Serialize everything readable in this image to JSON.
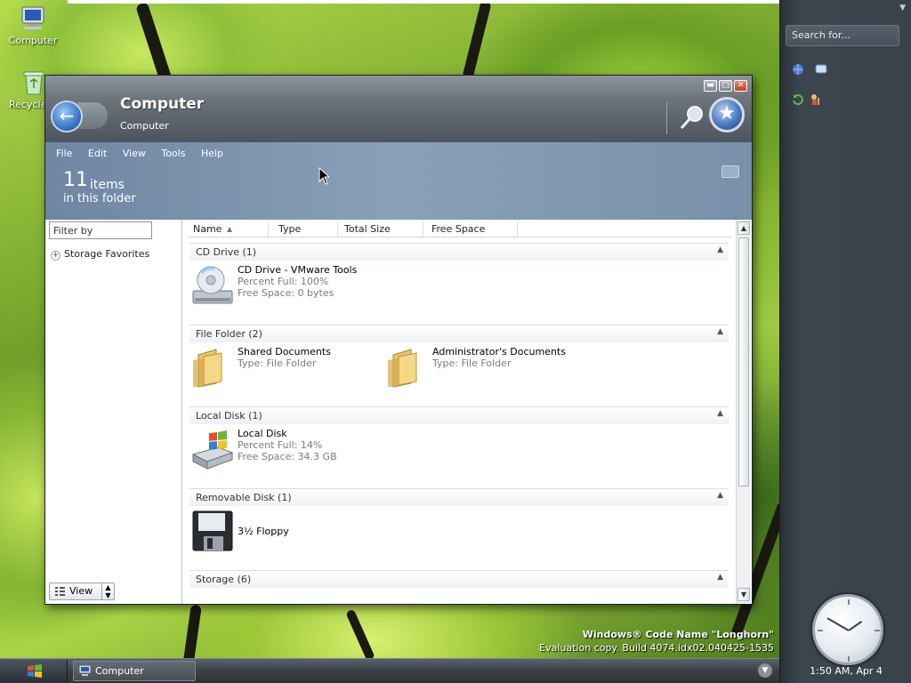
{
  "desktop": {
    "icons": [
      {
        "label": "Computer",
        "icon": "computer-icon"
      },
      {
        "label": "Recycle",
        "icon": "recycle-bin-icon"
      }
    ],
    "watermark": {
      "line1": "Windows® Code Name \"Longhorn\"",
      "line2": "Evaluation copy. Build 4074.idx02.040425-1535"
    }
  },
  "sidebar": {
    "search_placeholder": "Search for...",
    "clock_time": "1:50 AM, Apr 4"
  },
  "taskbar": {
    "task_label": "Computer"
  },
  "window": {
    "title": "Computer",
    "breadcrumb": "Computer",
    "menu": [
      "File",
      "Edit",
      "View",
      "Tools",
      "Help"
    ],
    "item_count": "11",
    "item_count_label": "items",
    "item_count_sub": "in this folder",
    "filter_placeholder": "Filter by",
    "nav_favorites": "Storage Favorites",
    "view_label": "View",
    "columns": [
      "Name",
      "Type",
      "Total Size",
      "Free Space"
    ],
    "groups": [
      {
        "header": "CD Drive (1)",
        "items": [
          {
            "name": "CD Drive - VMware Tools",
            "detail1": "Percent Full: 100%",
            "detail2": "Free Space: 0 bytes",
            "icon": "cd-drive-icon"
          }
        ]
      },
      {
        "header": "File Folder (2)",
        "items": [
          {
            "name": "Shared Documents",
            "detail1": "Type: File Folder",
            "icon": "folder-icon"
          },
          {
            "name": "Administrator's Documents",
            "detail1": "Type: File Folder",
            "icon": "folder-icon"
          }
        ]
      },
      {
        "header": "Local Disk (1)",
        "items": [
          {
            "name": "Local Disk",
            "detail1": "Percent Full: 14%",
            "detail2": "Free Space: 34.3 GB",
            "icon": "hard-disk-icon"
          }
        ]
      },
      {
        "header": "Removable Disk (1)",
        "items": [
          {
            "name": "3½ Floppy",
            "icon": "floppy-icon"
          }
        ]
      },
      {
        "header": "Storage (6)",
        "items": []
      }
    ]
  },
  "colors": {
    "accent": "#3a78c8",
    "infobar": "#8aa0b8",
    "sidebar": "#3a434c"
  }
}
